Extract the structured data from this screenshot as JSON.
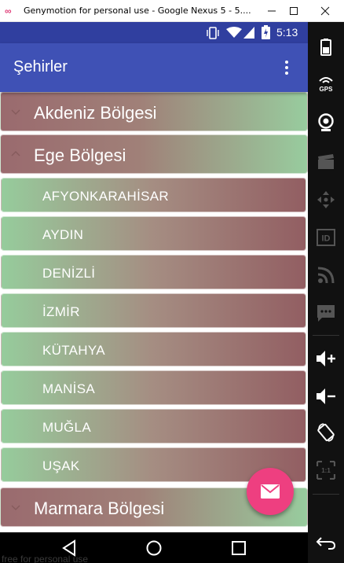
{
  "window": {
    "title": "Genymotion for personal use - Google Nexus 5 - 5...."
  },
  "statusbar": {
    "time": "5:13"
  },
  "appbar": {
    "title": "Şehirler"
  },
  "list": {
    "groups": [
      {
        "label": "Akdeniz Bölgesi",
        "expanded": false
      },
      {
        "label": "Ege Bölgesi",
        "expanded": true
      },
      {
        "label": "Marmara Bölgesi",
        "expanded": false
      }
    ],
    "children": [
      "AFYONKARAHİSAR",
      "AYDIN",
      "DENİZLİ",
      "İZMİR",
      "KÜTAHYA",
      "MANİSA",
      "MUĞLA",
      "UŞAK"
    ]
  },
  "fab": {
    "icon": "email-icon",
    "color": "#ee3f80"
  },
  "navbar": {
    "icons": [
      "back-icon",
      "home-icon",
      "recents-icon"
    ]
  },
  "sidepanel": {
    "icons": [
      "battery-icon",
      "gps-icon",
      "webcam-icon",
      "clapperboard-icon",
      "dpad-icon",
      "id-icon",
      "rss-icon",
      "sms-icon",
      "volume-up-icon",
      "volume-down-icon",
      "rotate-icon",
      "scale-icon",
      "back-icon"
    ],
    "gps_label": "GPS",
    "id_label": "ID",
    "scale_label": "1:1"
  },
  "watermark": "free for personal use",
  "colors": {
    "statusbar": "#303f9f",
    "appbar": "#3f51b5",
    "fab": "#ee3f80"
  }
}
